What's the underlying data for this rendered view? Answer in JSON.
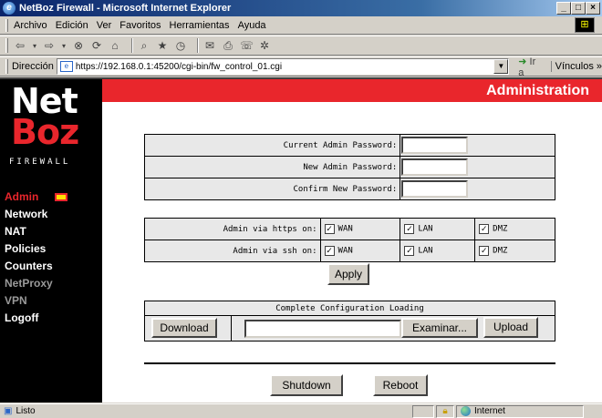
{
  "window": {
    "title": "NetBoz Firewall - Microsoft Internet Explorer",
    "controls": [
      "_",
      "□",
      "×"
    ]
  },
  "menu": [
    "Archivo",
    "Edición",
    "Ver",
    "Favoritos",
    "Herramientas",
    "Ayuda"
  ],
  "toolbar_icons": [
    "back-icon",
    "forward-icon",
    "stop-icon",
    "refresh-icon",
    "home-icon",
    "search-icon",
    "favorites-icon",
    "history-icon",
    "mail-icon",
    "print-icon",
    "discuss-icon",
    "messenger-icon"
  ],
  "address": {
    "label": "Dirección",
    "url": "https://192.168.0.1:45200/cgi-bin/fw_control_01.cgi",
    "go_label": "Ir a",
    "links_label": "Vínculos »"
  },
  "page": {
    "section_title": "Administration",
    "logo": {
      "top": "Net",
      "bottom": "Boz",
      "tagline": "FIREWALL"
    },
    "nav": [
      {
        "label": "Admin",
        "state": "active"
      },
      {
        "label": "Network",
        "state": "normal"
      },
      {
        "label": "NAT",
        "state": "normal"
      },
      {
        "label": "Policies",
        "state": "normal"
      },
      {
        "label": "Counters",
        "state": "normal"
      },
      {
        "label": "NetProxy",
        "state": "disabled"
      },
      {
        "label": "VPN",
        "state": "disabled"
      },
      {
        "label": "Logoff",
        "state": "normal"
      }
    ],
    "passwords": {
      "current": "Current Admin Password:",
      "new": "New Admin Password:",
      "confirm": "Confirm New Password:"
    },
    "access": {
      "https_label": "Admin via https on:",
      "ssh_label": "Admin via ssh on:",
      "zones": [
        "WAN",
        "LAN",
        "DMZ"
      ],
      "https_checked": [
        true,
        true,
        true
      ],
      "ssh_checked": [
        true,
        true,
        true
      ]
    },
    "apply_label": "Apply",
    "config": {
      "title": "Complete Configuration Loading",
      "download_label": "Download",
      "browse_label": "Examinar...",
      "upload_label": "Upload",
      "file_value": ""
    },
    "shutdown_label": "Shutdown",
    "reboot_label": "Reboot"
  },
  "status": {
    "text": "Listo",
    "zone": "Internet"
  }
}
